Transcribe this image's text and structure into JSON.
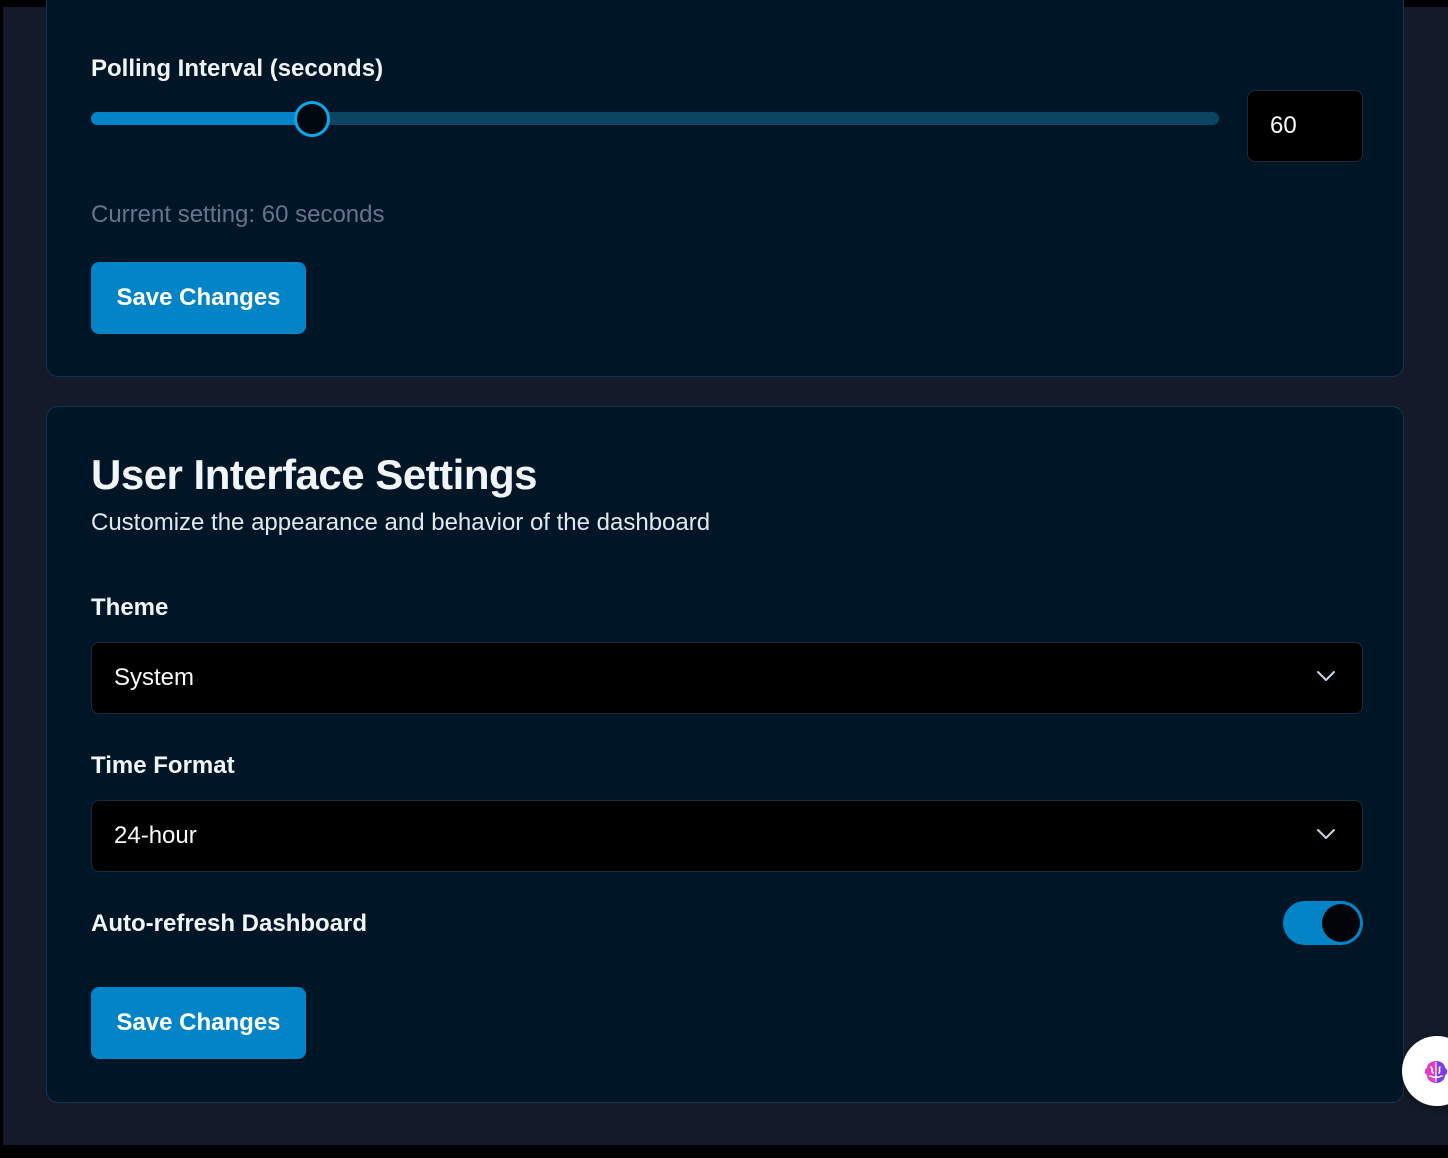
{
  "polling": {
    "label": "Polling Interval (seconds)",
    "slider_value": 60,
    "slider_fill_fraction": 0.195,
    "input_value": "60",
    "hint": "Current setting: 60 seconds",
    "save_label": "Save Changes"
  },
  "ui_settings": {
    "title": "User Interface Settings",
    "subtitle": "Customize the appearance and behavior of the dashboard",
    "theme": {
      "label": "Theme",
      "selected": "System"
    },
    "time_format": {
      "label": "Time Format",
      "selected": "24-hour"
    },
    "auto_refresh": {
      "label": "Auto-refresh Dashboard",
      "enabled": true
    },
    "save_label": "Save Changes"
  },
  "icons": {
    "select_arrow": "chevron-down-icon",
    "floating_widget": "brain-icon"
  },
  "colors": {
    "accent": "#0284c7",
    "card_bg": "#001627",
    "page_bg": "#141a29"
  }
}
